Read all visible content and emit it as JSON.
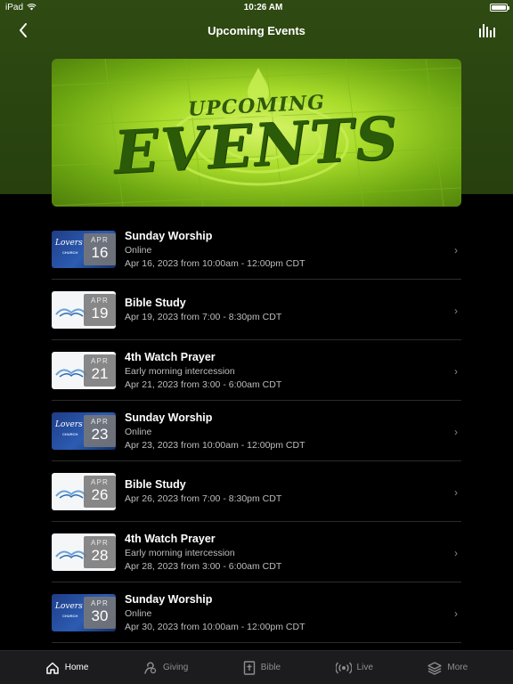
{
  "status": {
    "device": "iPad",
    "time": "10:26 AM"
  },
  "header": {
    "title": "Upcoming Events"
  },
  "banner": {
    "word1": "UPCOMING",
    "word2": "EVENTS"
  },
  "thumbs": {
    "church_name": "Lovers",
    "church_sub": "CHURCH"
  },
  "events": [
    {
      "title": "Sunday Worship",
      "subtitle": "Online",
      "time": "Apr 16, 2023 from 10:00am - 12:00pm CDT",
      "month": "APR",
      "day": "16",
      "thumb": "blue"
    },
    {
      "title": "Bible Study",
      "subtitle": "",
      "time": "Apr 19, 2023 from 7:00 - 8:30pm CDT",
      "month": "APR",
      "day": "19",
      "thumb": "white"
    },
    {
      "title": "4th Watch Prayer",
      "subtitle": "Early morning intercession",
      "time": "Apr 21, 2023 from 3:00 - 6:00am CDT",
      "month": "APR",
      "day": "21",
      "thumb": "white"
    },
    {
      "title": "Sunday Worship",
      "subtitle": "Online",
      "time": "Apr 23, 2023 from 10:00am - 12:00pm CDT",
      "month": "APR",
      "day": "23",
      "thumb": "blue"
    },
    {
      "title": "Bible Study",
      "subtitle": "",
      "time": "Apr 26, 2023 from 7:00 - 8:30pm CDT",
      "month": "APR",
      "day": "26",
      "thumb": "white"
    },
    {
      "title": "4th Watch Prayer",
      "subtitle": "Early morning intercession",
      "time": "Apr 28, 2023 from 3:00 - 6:00am CDT",
      "month": "APR",
      "day": "28",
      "thumb": "white"
    },
    {
      "title": "Sunday Worship",
      "subtitle": "Online",
      "time": "Apr 30, 2023 from 10:00am - 12:00pm CDT",
      "month": "APR",
      "day": "30",
      "thumb": "blue"
    }
  ],
  "tabs": [
    {
      "label": "Home",
      "icon": "home-icon",
      "active": true
    },
    {
      "label": "Giving",
      "icon": "giving-icon",
      "active": false
    },
    {
      "label": "Bible",
      "icon": "bible-icon",
      "active": false
    },
    {
      "label": "Live",
      "icon": "live-icon",
      "active": false
    },
    {
      "label": "More",
      "icon": "layers-icon",
      "active": false
    }
  ],
  "colors": {
    "header_green": "#2f4a12",
    "banner_green": "#a9dc2a",
    "tab_bar": "#1c1c1e"
  }
}
